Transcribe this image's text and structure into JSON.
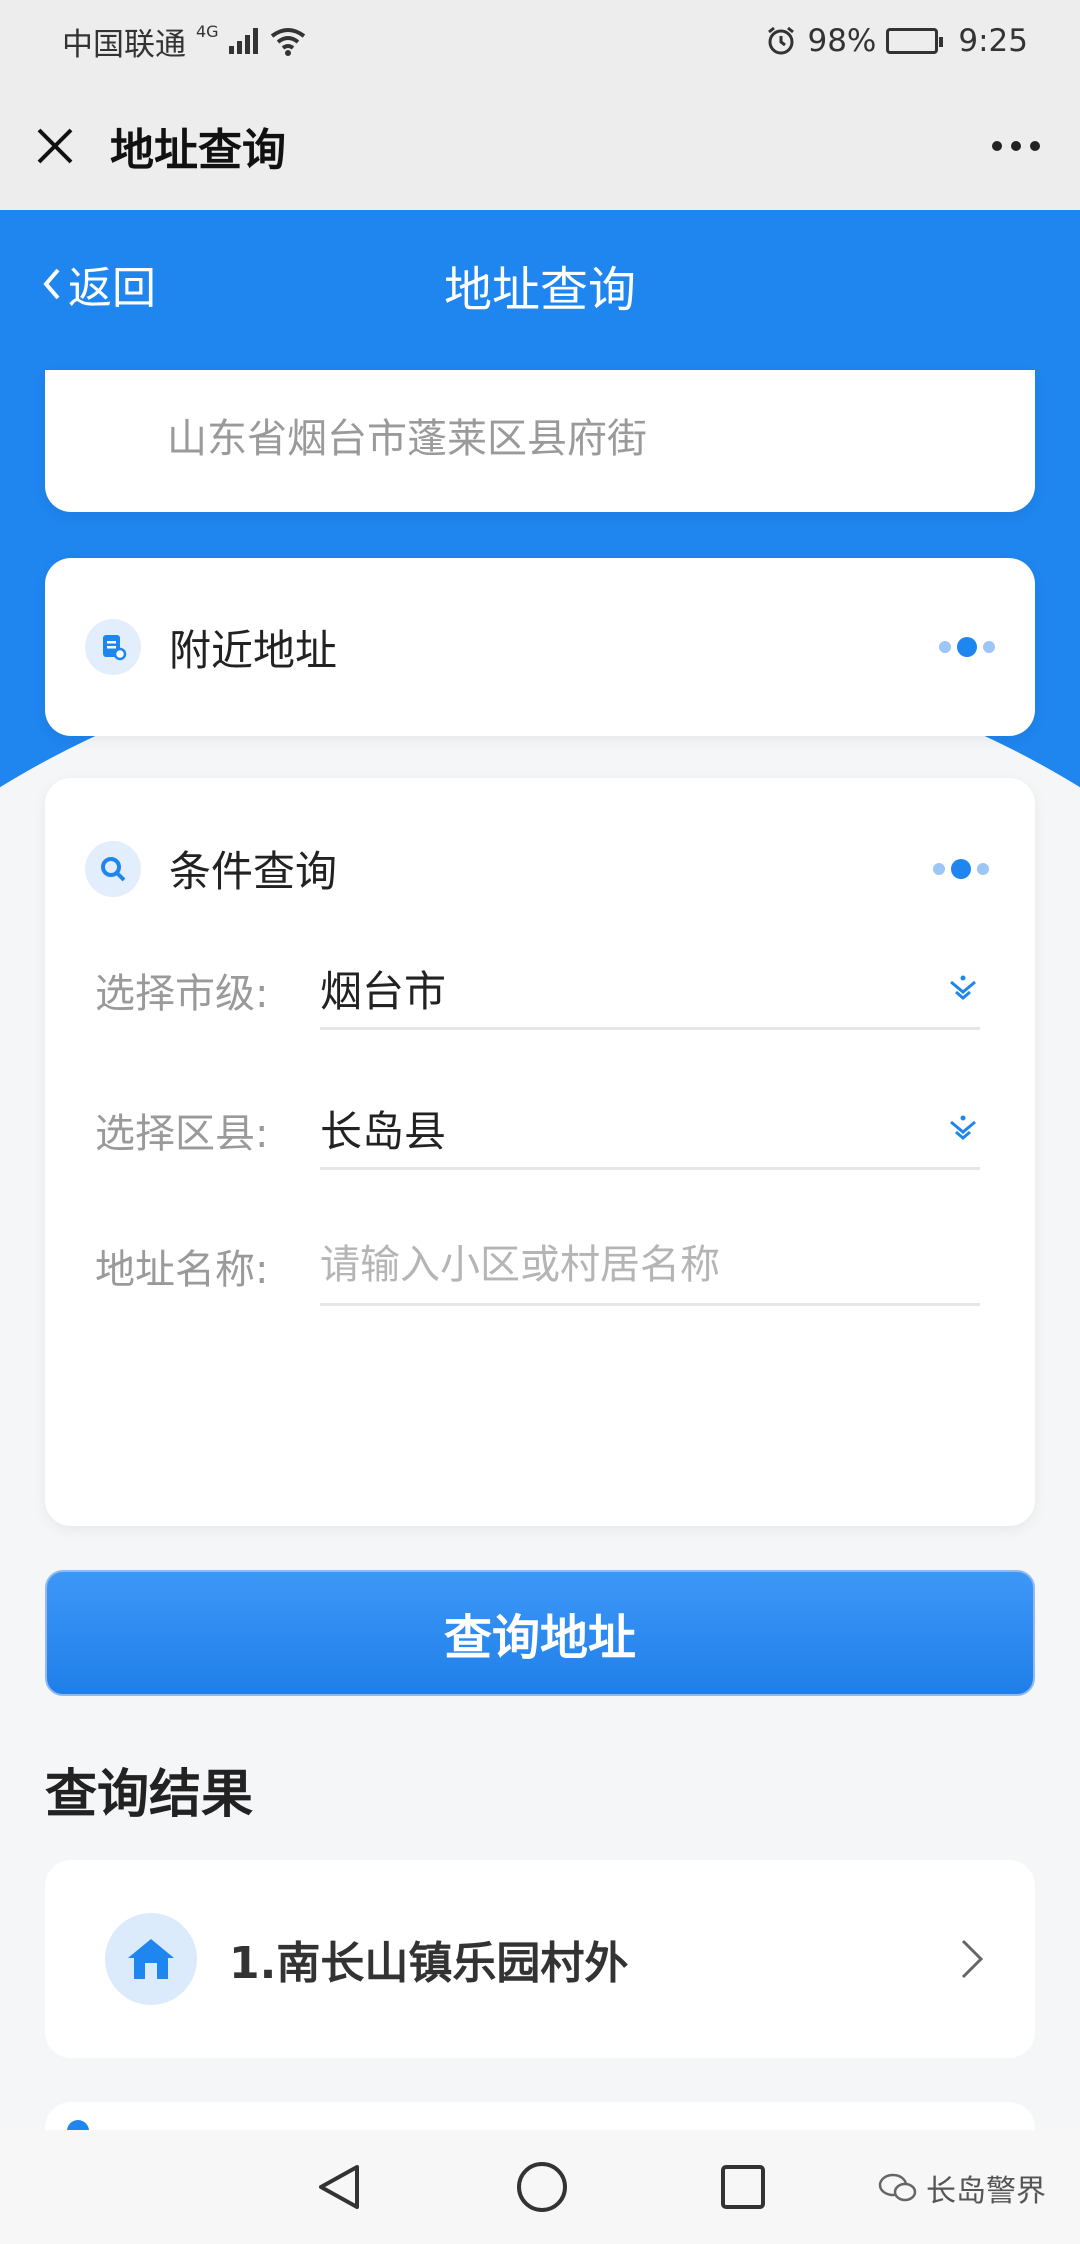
{
  "status_bar": {
    "carrier": "中国联通",
    "network": "4G",
    "battery": "98%",
    "battery_level": 0.98,
    "time": "9:25"
  },
  "titlebar": {
    "title": "地址查询",
    "close_icon": "close-icon",
    "more_icon": "more-icon"
  },
  "header": {
    "back_label": "返回",
    "title": "地址查询"
  },
  "location": {
    "text": "山东省烟台市蓬莱区县府街"
  },
  "nearby": {
    "label": "附近地址",
    "icon": "document-icon"
  },
  "search": {
    "label": "条件查询",
    "icon": "search-icon",
    "city_label": "选择市级:",
    "city_value": "烟台市",
    "district_label": "选择区县:",
    "district_value": "长岛县",
    "name_label": "地址名称:",
    "name_placeholder": "请输入小区或村居名称",
    "name_value": ""
  },
  "query_button": "查询地址",
  "results": {
    "title": "查询结果",
    "items": [
      {
        "label": "1.南长山镇乐园村外",
        "icon": "home-icon"
      }
    ]
  },
  "watermark": "长岛警界",
  "colors": {
    "primary": "#1f85ef",
    "background": "#f5f6f8"
  }
}
